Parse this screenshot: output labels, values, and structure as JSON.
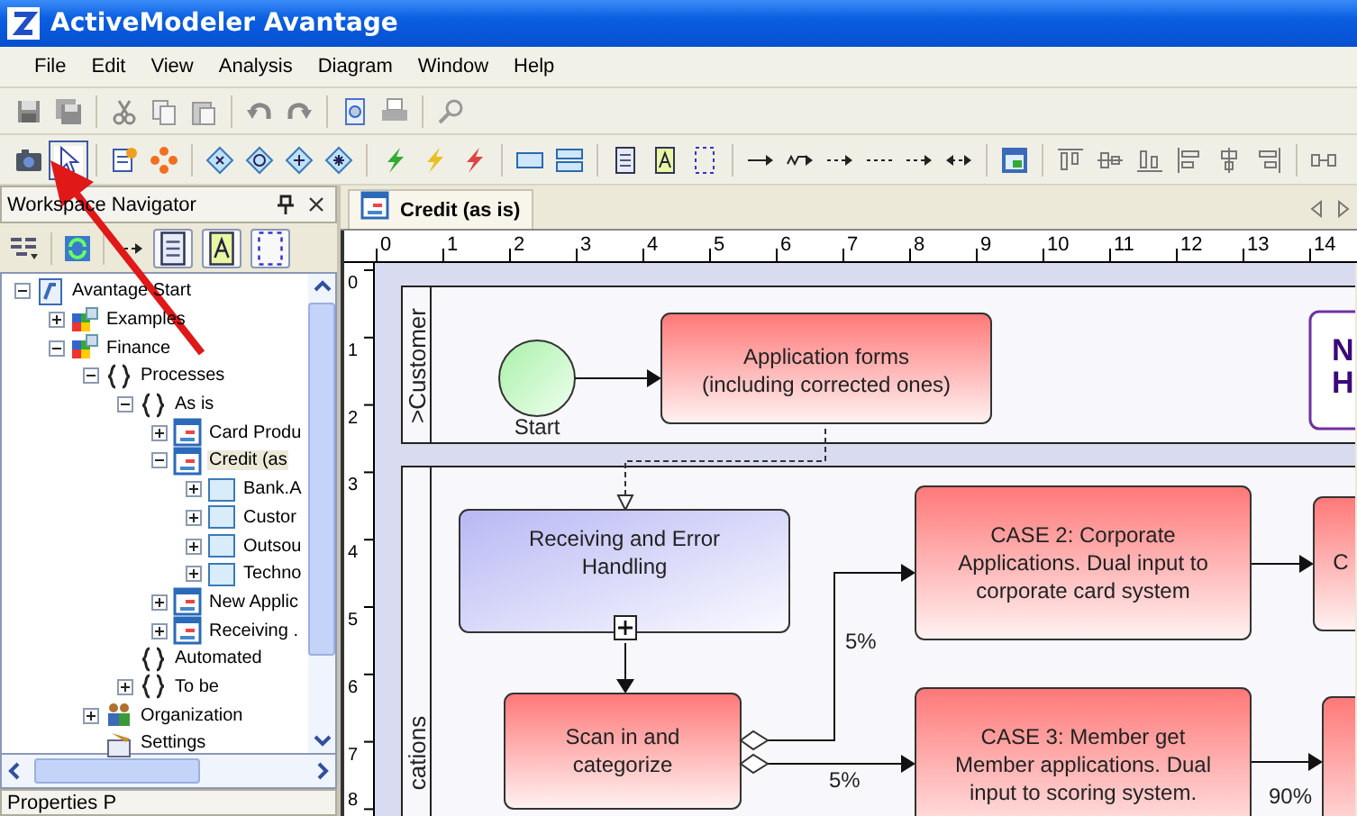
{
  "window": {
    "title": "ActiveModeler Avantage"
  },
  "menu": [
    "File",
    "Edit",
    "View",
    "Analysis",
    "Diagram",
    "Window",
    "Help"
  ],
  "navigator": {
    "title": "Workspace Navigator",
    "tree": [
      {
        "label": "Avantage Start",
        "kind": "workspace",
        "expanded": true,
        "selected": false,
        "children": [
          {
            "label": "Examples",
            "kind": "project",
            "expanded": false,
            "selected": false
          },
          {
            "label": "Finance",
            "kind": "project",
            "expanded": true,
            "selected": false,
            "children": [
              {
                "label": "Processes",
                "kind": "folder",
                "expanded": true,
                "selected": false,
                "children": [
                  {
                    "label": "As is",
                    "kind": "folder",
                    "expanded": true,
                    "selected": false,
                    "children": [
                      {
                        "label": "Card Produ",
                        "kind": "diagram",
                        "expanded": false,
                        "selected": false
                      },
                      {
                        "label": "Credit (as",
                        "kind": "diagram",
                        "expanded": true,
                        "selected": true,
                        "children": [
                          {
                            "label": "Bank.A",
                            "kind": "lane",
                            "expanded": false,
                            "selected": false
                          },
                          {
                            "label": "Custor",
                            "kind": "lane",
                            "expanded": false,
                            "selected": false
                          },
                          {
                            "label": "Outsou",
                            "kind": "lane",
                            "expanded": false,
                            "selected": false
                          },
                          {
                            "label": "Techno",
                            "kind": "lane",
                            "expanded": false,
                            "selected": false
                          }
                        ]
                      },
                      {
                        "label": "New Applic",
                        "kind": "diagram",
                        "expanded": false,
                        "selected": false
                      },
                      {
                        "label": "Receiving .",
                        "kind": "diagram",
                        "expanded": false,
                        "selected": false
                      }
                    ]
                  },
                  {
                    "label": "Automated",
                    "kind": "folder",
                    "selected": false
                  },
                  {
                    "label": "To be",
                    "kind": "folder",
                    "expanded": false,
                    "selected": false
                  }
                ]
              },
              {
                "label": "Organization",
                "kind": "organization",
                "expanded": false,
                "selected": false
              },
              {
                "label": "Settings",
                "kind": "settings",
                "selected": false
              }
            ]
          }
        ]
      }
    ]
  },
  "properties_panel": {
    "title": "Properties P"
  },
  "tabs": [
    {
      "label": "Credit (as is)",
      "selected": true
    }
  ],
  "ruler": {
    "horizontal": [
      "0",
      "1",
      "2",
      "3",
      "4",
      "5",
      "6",
      "7",
      "8",
      "9",
      "10",
      "11",
      "12",
      "13",
      "14"
    ],
    "vertical": [
      "0",
      "1",
      "2",
      "3",
      "4",
      "5",
      "6",
      "7",
      "8"
    ]
  },
  "diagram": {
    "lanes": [
      {
        "label": ">Customer"
      },
      {
        "label": "cations"
      }
    ],
    "start_event": {
      "label": "Start"
    },
    "tasks": [
      {
        "lines": [
          "Application forms",
          "(including corrected ones)"
        ],
        "kind": "red"
      },
      {
        "lines": [
          "Receiving and Error",
          "Handling"
        ],
        "kind": "subprocess"
      },
      {
        "lines": [
          "Scan in and",
          "categorize"
        ],
        "kind": "red"
      },
      {
        "lines": [
          "CASE 2: Corporate",
          "Applications.  Dual input to",
          "corporate card system"
        ],
        "kind": "red"
      },
      {
        "lines": [
          "CASE 3: Member get",
          "Member applications. Dual",
          "input to scoring system."
        ],
        "kind": "red"
      },
      {
        "lines": [
          "C"
        ],
        "kind": "red"
      },
      {
        "kind": "red"
      },
      {
        "lines": [
          "N",
          "H"
        ],
        "kind": "note"
      }
    ],
    "flow_labels": [
      "5%",
      "5%",
      "90%"
    ]
  }
}
